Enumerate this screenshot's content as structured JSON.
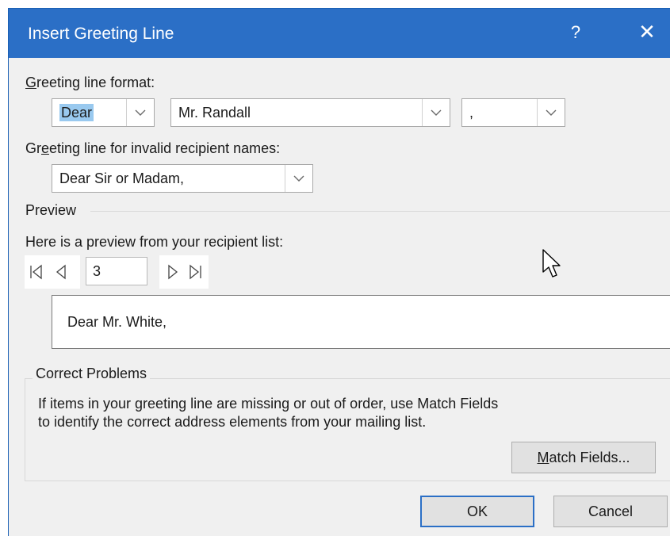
{
  "dialog": {
    "title": "Insert Greeting Line",
    "help": "?",
    "close": "✕"
  },
  "greeting_format": {
    "label_prefix": "G",
    "label_rest": "reeting line format:",
    "salutation": "Dear",
    "name_format": "Mr. Randall",
    "punctuation": ","
  },
  "invalid_names": {
    "label_pre": "Gr",
    "label_u": "e",
    "label_rest": "eting line for invalid recipient names:",
    "value": "Dear Sir or Madam,"
  },
  "preview": {
    "section_label": "Preview",
    "caption": "Here is a preview from your recipient list:",
    "record": "3",
    "text": "Dear Mr. White,"
  },
  "correct_problems": {
    "title": "Correct Problems",
    "line1": "If items in your greeting line are missing or out of order, use Match Fields",
    "line2": "to identify the correct address elements from your mailing list.",
    "match_pre": "",
    "match_u": "M",
    "match_rest": "atch Fields..."
  },
  "buttons": {
    "ok": "OK",
    "cancel": "Cancel"
  },
  "icons": {
    "first": "first-record-icon",
    "prev": "previous-record-icon",
    "next": "next-record-icon",
    "last": "last-record-icon",
    "dropdown": "chevron-down-icon"
  },
  "colors": {
    "titlebar": "#2b6fc6",
    "selection": "#99c9ef",
    "default_button_border": "#2b6fc6"
  }
}
